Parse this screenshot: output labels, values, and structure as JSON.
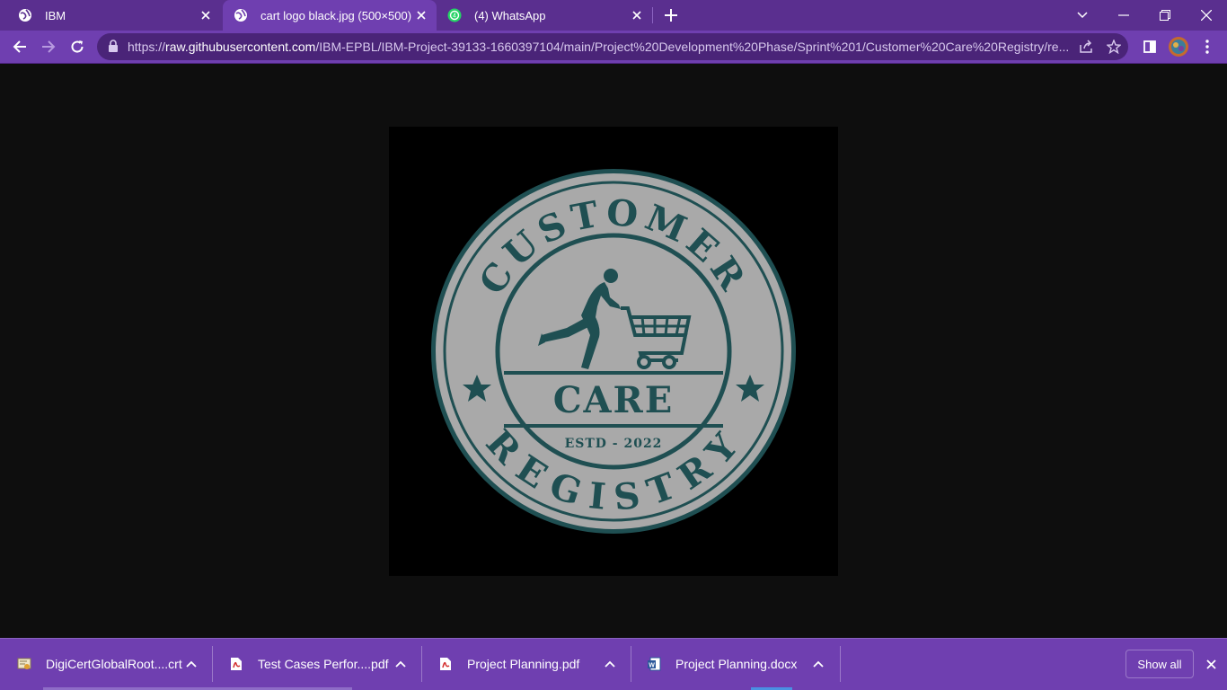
{
  "tabs": [
    {
      "title": "IBM",
      "favicon": "globe-icon",
      "active": false
    },
    {
      "title": "cart logo black.jpg (500×500)",
      "favicon": "globe-icon",
      "active": true
    },
    {
      "title": "(4) WhatsApp",
      "favicon": "whatsapp-icon",
      "active": false
    }
  ],
  "address_bar": {
    "url_prefix": "https://",
    "url_host": "raw.githubusercontent.com",
    "url_path": "/IBM-EPBL/IBM-Project-39133-1660397104/main/Project%20Development%20Phase/Sprint%201/Customer%20Care%20Registry/re..."
  },
  "logo": {
    "top_text": "CUSTOMER",
    "middle_text": "CARE",
    "established": "ESTD - 2022",
    "bottom_text": "REGISTRY"
  },
  "downloads": [
    {
      "name": "DigiCertGlobalRoot....crt",
      "icon": "certificate-file-icon"
    },
    {
      "name": "Test Cases Perfor....pdf",
      "icon": "pdf-file-icon"
    },
    {
      "name": "Project Planning.pdf",
      "icon": "pdf-file-icon"
    },
    {
      "name": "Project Planning.docx",
      "icon": "word-file-icon"
    }
  ],
  "downloads_bar": {
    "show_all_label": "Show all"
  },
  "colors": {
    "tabstrip": "#5a2f8f",
    "toolbar": "#6f3fb0",
    "logo_teal": "#1f4f52",
    "logo_gray": "#a9a9a9"
  }
}
